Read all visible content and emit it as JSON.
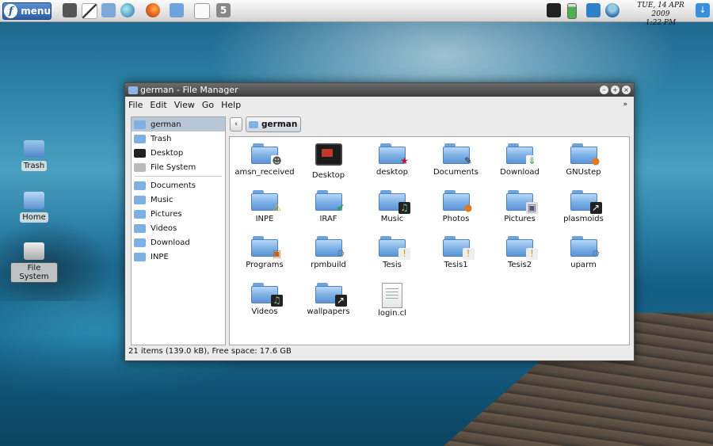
{
  "panel": {
    "menu_label": "menu",
    "clock_date": "TUE, 14 APR 2009",
    "clock_time": "1:22 PM",
    "launchers": [
      "terminal-icon",
      "text-editor-icon",
      "archive-icon",
      "globe-icon",
      "firefox-icon",
      "home-folder-icon",
      "document-icon",
      "calculator-icon"
    ],
    "tray": [
      "display-icon",
      "battery-icon",
      "network-icon",
      "user-icon",
      "update-icon"
    ]
  },
  "desktop": {
    "icons": [
      {
        "label": "Trash"
      },
      {
        "label": "Home"
      },
      {
        "label": "File System"
      }
    ]
  },
  "window": {
    "title": "german - File Manager",
    "menus": [
      "File",
      "Edit",
      "View",
      "Go",
      "Help"
    ],
    "sidebar": [
      {
        "label": "german",
        "icon": "home-icon"
      },
      {
        "label": "Trash",
        "icon": "trash-icon"
      },
      {
        "label": "Desktop",
        "icon": "desktop-icon"
      },
      {
        "label": "File System",
        "icon": "drive-icon"
      },
      {
        "label": "Documents",
        "icon": "folder-icon"
      },
      {
        "label": "Music",
        "icon": "folder-icon"
      },
      {
        "label": "Pictures",
        "icon": "folder-icon"
      },
      {
        "label": "Videos",
        "icon": "folder-icon"
      },
      {
        "label": "Download",
        "icon": "folder-icon"
      },
      {
        "label": "INPE",
        "icon": "folder-icon"
      }
    ],
    "location": "german",
    "files": [
      {
        "name": "amsn_received",
        "kind": "folder",
        "emblem": "person"
      },
      {
        "name": "Desktop",
        "kind": "monitor",
        "emblem": ""
      },
      {
        "name": "desktop",
        "kind": "folder",
        "emblem": "star"
      },
      {
        "name": "Documents",
        "kind": "folder",
        "emblem": "pencil"
      },
      {
        "name": "Download",
        "kind": "folder",
        "emblem": "down-arrow"
      },
      {
        "name": "GNUstep",
        "kind": "folder",
        "emblem": "balls"
      },
      {
        "name": "INPE",
        "kind": "folder",
        "emblem": "warning"
      },
      {
        "name": "IRAF",
        "kind": "folder",
        "emblem": "check"
      },
      {
        "name": "Music",
        "kind": "folder",
        "emblem": "film"
      },
      {
        "name": "Photos",
        "kind": "folder",
        "emblem": "balls"
      },
      {
        "name": "Pictures",
        "kind": "folder",
        "emblem": "photo"
      },
      {
        "name": "plasmoids",
        "kind": "folder",
        "emblem": "link"
      },
      {
        "name": "Programs",
        "kind": "folder",
        "emblem": "package"
      },
      {
        "name": "rpmbuild",
        "kind": "folder",
        "emblem": "gear"
      },
      {
        "name": "Tesis",
        "kind": "folder",
        "emblem": "important"
      },
      {
        "name": "Tesis1",
        "kind": "folder",
        "emblem": "important"
      },
      {
        "name": "Tesis2",
        "kind": "folder",
        "emblem": "important"
      },
      {
        "name": "uparm",
        "kind": "folder",
        "emblem": "gear"
      },
      {
        "name": "Videos",
        "kind": "folder",
        "emblem": "film"
      },
      {
        "name": "wallpapers",
        "kind": "folder",
        "emblem": "link"
      },
      {
        "name": "login.cl",
        "kind": "document",
        "emblem": ""
      }
    ],
    "status": "21 items (139.0 kB), Free space: 17.6 GB"
  },
  "colors": {
    "accent": "#2d5fa5",
    "folder": "#79aee6",
    "selection": "#b9c6d6"
  }
}
